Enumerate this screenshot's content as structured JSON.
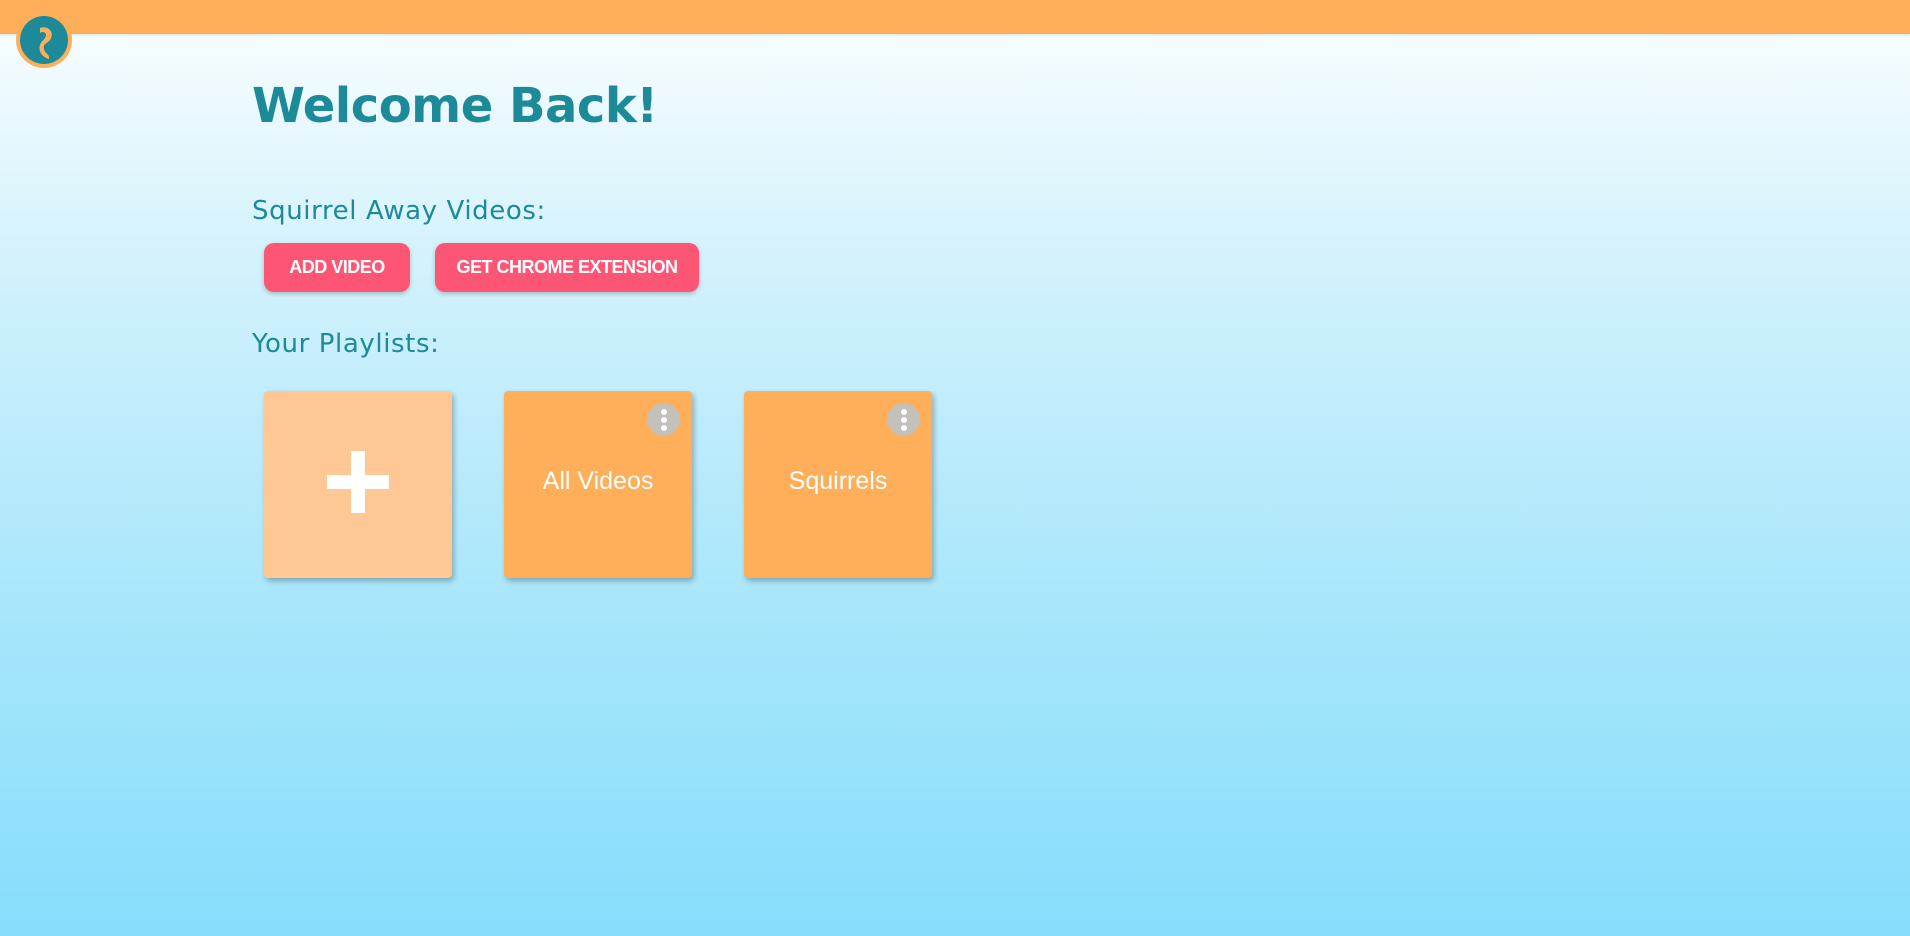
{
  "header": {
    "logo_icon": "squirrel-tail-logo-icon",
    "brand_color": "#ffae5a"
  },
  "main": {
    "title": "Welcome Back!",
    "videos_heading": "Squirrel Away Videos:",
    "buttons": {
      "add_video": "ADD VIDEO",
      "chrome_extension": "GET CHROME EXTENSION"
    },
    "playlists_heading": "Your Playlists:",
    "new_playlist_icon": "plus-icon",
    "playlists": [
      {
        "label": "All Videos",
        "menu_icon": "more-vertical-icon"
      },
      {
        "label": "Squirrels",
        "menu_icon": "more-vertical-icon"
      }
    ]
  },
  "colors": {
    "accent_orange": "#ffae5a",
    "light_orange": "#ffc794",
    "button_pink": "#fd5675",
    "heading_teal": "#1c8a99",
    "background_top": "#fbfeff",
    "background_bottom": "#86ddfc"
  }
}
